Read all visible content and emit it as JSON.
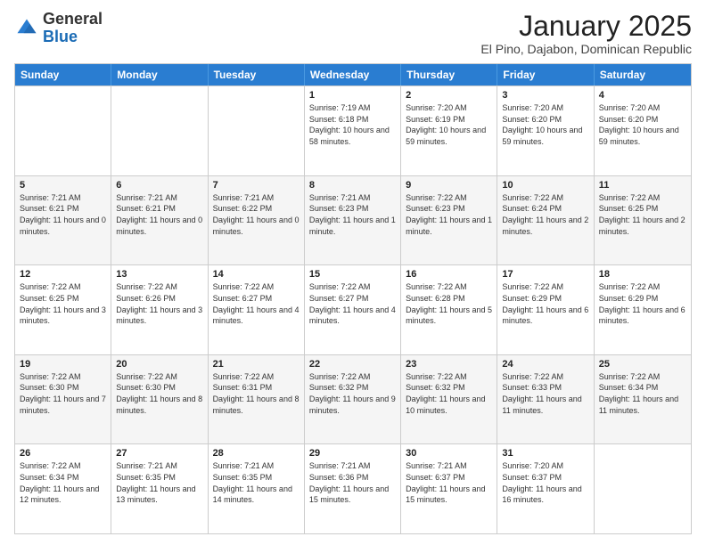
{
  "logo": {
    "general": "General",
    "blue": "Blue"
  },
  "header": {
    "month": "January 2025",
    "location": "El Pino, Dajabon, Dominican Republic"
  },
  "weekdays": [
    "Sunday",
    "Monday",
    "Tuesday",
    "Wednesday",
    "Thursday",
    "Friday",
    "Saturday"
  ],
  "weeks": [
    [
      {
        "day": "",
        "sunrise": "",
        "sunset": "",
        "daylight": ""
      },
      {
        "day": "",
        "sunrise": "",
        "sunset": "",
        "daylight": ""
      },
      {
        "day": "",
        "sunrise": "",
        "sunset": "",
        "daylight": ""
      },
      {
        "day": "1",
        "sunrise": "Sunrise: 7:19 AM",
        "sunset": "Sunset: 6:18 PM",
        "daylight": "Daylight: 10 hours and 58 minutes."
      },
      {
        "day": "2",
        "sunrise": "Sunrise: 7:20 AM",
        "sunset": "Sunset: 6:19 PM",
        "daylight": "Daylight: 10 hours and 59 minutes."
      },
      {
        "day": "3",
        "sunrise": "Sunrise: 7:20 AM",
        "sunset": "Sunset: 6:20 PM",
        "daylight": "Daylight: 10 hours and 59 minutes."
      },
      {
        "day": "4",
        "sunrise": "Sunrise: 7:20 AM",
        "sunset": "Sunset: 6:20 PM",
        "daylight": "Daylight: 10 hours and 59 minutes."
      }
    ],
    [
      {
        "day": "5",
        "sunrise": "Sunrise: 7:21 AM",
        "sunset": "Sunset: 6:21 PM",
        "daylight": "Daylight: 11 hours and 0 minutes."
      },
      {
        "day": "6",
        "sunrise": "Sunrise: 7:21 AM",
        "sunset": "Sunset: 6:21 PM",
        "daylight": "Daylight: 11 hours and 0 minutes."
      },
      {
        "day": "7",
        "sunrise": "Sunrise: 7:21 AM",
        "sunset": "Sunset: 6:22 PM",
        "daylight": "Daylight: 11 hours and 0 minutes."
      },
      {
        "day": "8",
        "sunrise": "Sunrise: 7:21 AM",
        "sunset": "Sunset: 6:23 PM",
        "daylight": "Daylight: 11 hours and 1 minute."
      },
      {
        "day": "9",
        "sunrise": "Sunrise: 7:22 AM",
        "sunset": "Sunset: 6:23 PM",
        "daylight": "Daylight: 11 hours and 1 minute."
      },
      {
        "day": "10",
        "sunrise": "Sunrise: 7:22 AM",
        "sunset": "Sunset: 6:24 PM",
        "daylight": "Daylight: 11 hours and 2 minutes."
      },
      {
        "day": "11",
        "sunrise": "Sunrise: 7:22 AM",
        "sunset": "Sunset: 6:25 PM",
        "daylight": "Daylight: 11 hours and 2 minutes."
      }
    ],
    [
      {
        "day": "12",
        "sunrise": "Sunrise: 7:22 AM",
        "sunset": "Sunset: 6:25 PM",
        "daylight": "Daylight: 11 hours and 3 minutes."
      },
      {
        "day": "13",
        "sunrise": "Sunrise: 7:22 AM",
        "sunset": "Sunset: 6:26 PM",
        "daylight": "Daylight: 11 hours and 3 minutes."
      },
      {
        "day": "14",
        "sunrise": "Sunrise: 7:22 AM",
        "sunset": "Sunset: 6:27 PM",
        "daylight": "Daylight: 11 hours and 4 minutes."
      },
      {
        "day": "15",
        "sunrise": "Sunrise: 7:22 AM",
        "sunset": "Sunset: 6:27 PM",
        "daylight": "Daylight: 11 hours and 4 minutes."
      },
      {
        "day": "16",
        "sunrise": "Sunrise: 7:22 AM",
        "sunset": "Sunset: 6:28 PM",
        "daylight": "Daylight: 11 hours and 5 minutes."
      },
      {
        "day": "17",
        "sunrise": "Sunrise: 7:22 AM",
        "sunset": "Sunset: 6:29 PM",
        "daylight": "Daylight: 11 hours and 6 minutes."
      },
      {
        "day": "18",
        "sunrise": "Sunrise: 7:22 AM",
        "sunset": "Sunset: 6:29 PM",
        "daylight": "Daylight: 11 hours and 6 minutes."
      }
    ],
    [
      {
        "day": "19",
        "sunrise": "Sunrise: 7:22 AM",
        "sunset": "Sunset: 6:30 PM",
        "daylight": "Daylight: 11 hours and 7 minutes."
      },
      {
        "day": "20",
        "sunrise": "Sunrise: 7:22 AM",
        "sunset": "Sunset: 6:30 PM",
        "daylight": "Daylight: 11 hours and 8 minutes."
      },
      {
        "day": "21",
        "sunrise": "Sunrise: 7:22 AM",
        "sunset": "Sunset: 6:31 PM",
        "daylight": "Daylight: 11 hours and 8 minutes."
      },
      {
        "day": "22",
        "sunrise": "Sunrise: 7:22 AM",
        "sunset": "Sunset: 6:32 PM",
        "daylight": "Daylight: 11 hours and 9 minutes."
      },
      {
        "day": "23",
        "sunrise": "Sunrise: 7:22 AM",
        "sunset": "Sunset: 6:32 PM",
        "daylight": "Daylight: 11 hours and 10 minutes."
      },
      {
        "day": "24",
        "sunrise": "Sunrise: 7:22 AM",
        "sunset": "Sunset: 6:33 PM",
        "daylight": "Daylight: 11 hours and 11 minutes."
      },
      {
        "day": "25",
        "sunrise": "Sunrise: 7:22 AM",
        "sunset": "Sunset: 6:34 PM",
        "daylight": "Daylight: 11 hours and 11 minutes."
      }
    ],
    [
      {
        "day": "26",
        "sunrise": "Sunrise: 7:22 AM",
        "sunset": "Sunset: 6:34 PM",
        "daylight": "Daylight: 11 hours and 12 minutes."
      },
      {
        "day": "27",
        "sunrise": "Sunrise: 7:21 AM",
        "sunset": "Sunset: 6:35 PM",
        "daylight": "Daylight: 11 hours and 13 minutes."
      },
      {
        "day": "28",
        "sunrise": "Sunrise: 7:21 AM",
        "sunset": "Sunset: 6:35 PM",
        "daylight": "Daylight: 11 hours and 14 minutes."
      },
      {
        "day": "29",
        "sunrise": "Sunrise: 7:21 AM",
        "sunset": "Sunset: 6:36 PM",
        "daylight": "Daylight: 11 hours and 15 minutes."
      },
      {
        "day": "30",
        "sunrise": "Sunrise: 7:21 AM",
        "sunset": "Sunset: 6:37 PM",
        "daylight": "Daylight: 11 hours and 15 minutes."
      },
      {
        "day": "31",
        "sunrise": "Sunrise: 7:20 AM",
        "sunset": "Sunset: 6:37 PM",
        "daylight": "Daylight: 11 hours and 16 minutes."
      },
      {
        "day": "",
        "sunrise": "",
        "sunset": "",
        "daylight": ""
      }
    ]
  ]
}
